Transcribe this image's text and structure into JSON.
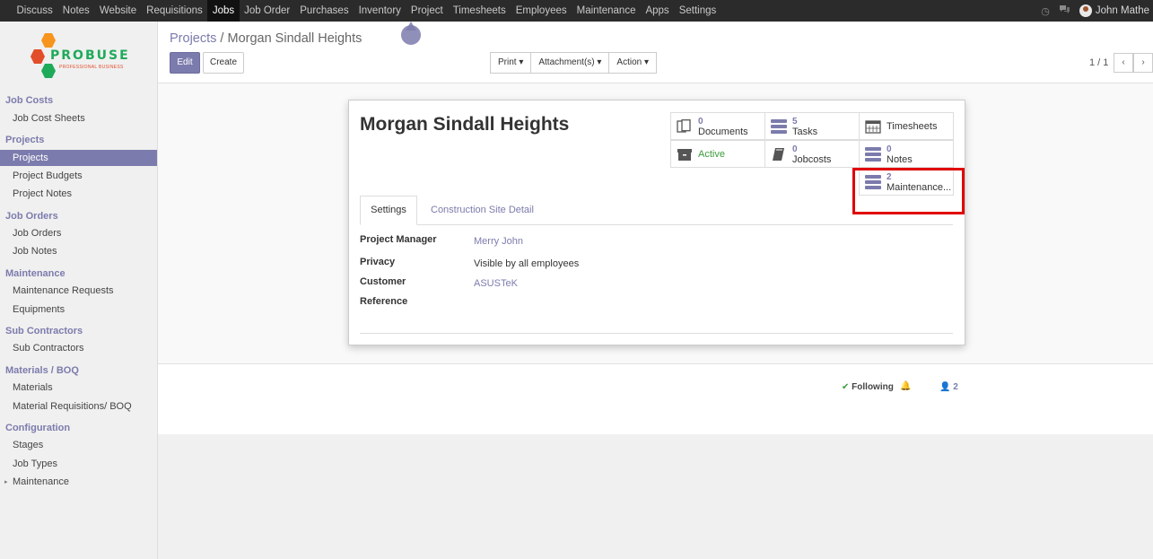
{
  "topnav": {
    "menu": [
      "Discuss",
      "Notes",
      "Website",
      "Requisitions",
      "Jobs",
      "Job Order",
      "Purchases",
      "Inventory",
      "Project",
      "Timesheets",
      "Employees",
      "Maintenance",
      "Apps",
      "Settings"
    ],
    "active": "Jobs",
    "user": "John Mathe"
  },
  "logo": {
    "brand": "PROBUSE",
    "tagline": "PROFESSIONAL BUSINESS"
  },
  "sidebar": {
    "job_costs": {
      "title": "Job Costs",
      "items": [
        "Job Cost Sheets"
      ]
    },
    "projects": {
      "title": "Projects",
      "items": [
        "Projects",
        "Project Budgets",
        "Project Notes"
      ]
    },
    "job_orders": {
      "title": "Job Orders",
      "items": [
        "Job Orders",
        "Job Notes"
      ]
    },
    "maintenance": {
      "title": "Maintenance",
      "items": [
        "Maintenance Requests",
        "Equipments"
      ]
    },
    "sub_contractors": {
      "title": "Sub Contractors",
      "items": [
        "Sub Contractors"
      ]
    },
    "materials": {
      "title": "Materials / BOQ",
      "items": [
        "Materials",
        "Material Requisitions/ BOQ"
      ]
    },
    "configuration": {
      "title": "Configuration",
      "items": [
        "Stages",
        "Job Types",
        "Maintenance"
      ]
    }
  },
  "breadcrumb": {
    "parent": "Projects",
    "sep": "/",
    "current": "Morgan Sindall Heights"
  },
  "buttons": {
    "edit": "Edit",
    "create": "Create",
    "print": "Print ▾",
    "attachments": "Attachment(s) ▾",
    "action": "Action ▾"
  },
  "pager": {
    "value": "1 / 1",
    "prev": "‹",
    "next": "›"
  },
  "record": {
    "title": "Morgan Sindall Heights",
    "smart_buttons": {
      "documents": {
        "count": "0",
        "label": "Documents"
      },
      "tasks": {
        "count": "5",
        "label": "Tasks"
      },
      "timesheets": {
        "label": "Timesheets"
      },
      "active": {
        "label": "Active"
      },
      "jobcosts": {
        "count": "0",
        "label": "Jobcosts"
      },
      "notes": {
        "count": "0",
        "label": "Notes"
      },
      "maintenance": {
        "count": "2",
        "label": "Maintenance..."
      }
    },
    "tabs": [
      "Settings",
      "Construction Site Detail"
    ],
    "fields": {
      "manager_label": "Project Manager",
      "manager": "Merry John",
      "privacy_label": "Privacy",
      "privacy": "Visible by all employees",
      "customer_label": "Customer",
      "customer": "ASUSTeK",
      "reference_label": "Reference"
    }
  },
  "chatter": {
    "following": "Following",
    "followers": "2"
  },
  "colors": {
    "accent": "#7c7bad",
    "highlight": "#e00000",
    "active_green": "#3c9b3c"
  }
}
